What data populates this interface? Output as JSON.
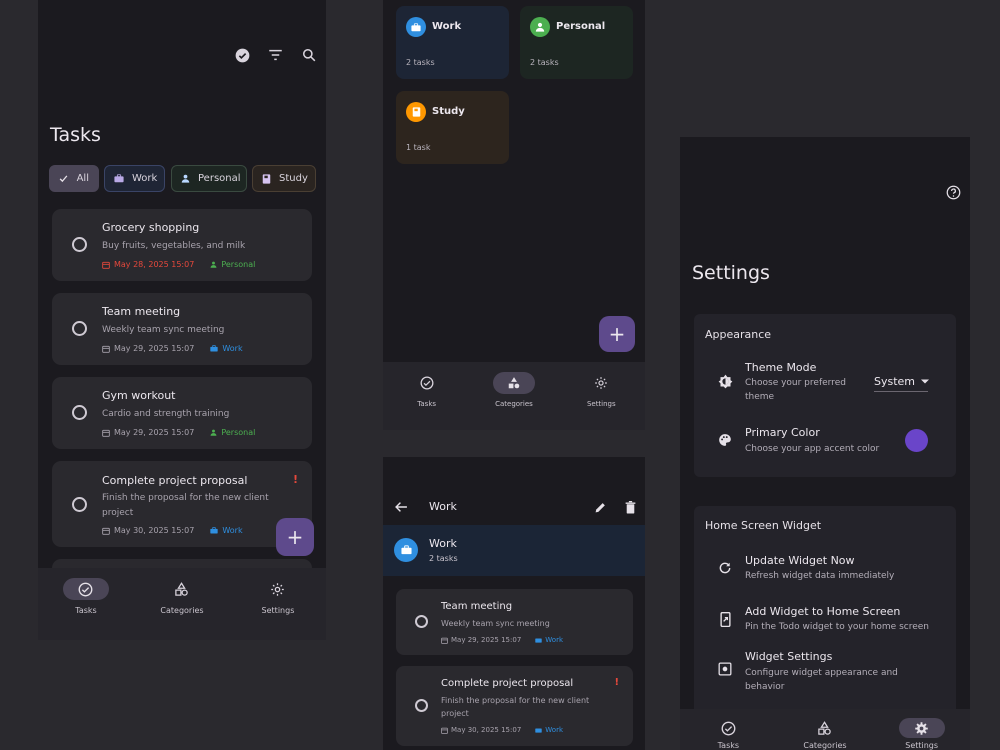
{
  "colors": {
    "accent": "#5e4a8c",
    "work": "#2f8fe0",
    "personal": "#4caf50",
    "study": "#ff9800",
    "danger": "#e5483c"
  },
  "tasks_screen": {
    "title": "Tasks",
    "filters": [
      {
        "label": "All",
        "icon": "check-icon"
      },
      {
        "label": "Work",
        "icon": "briefcase-icon"
      },
      {
        "label": "Personal",
        "icon": "person-icon"
      },
      {
        "label": "Study",
        "icon": "book-icon"
      }
    ],
    "tasks": [
      {
        "title": "Grocery shopping",
        "desc": "Buy fruits, vegetables, and milk",
        "date": "May 28, 2025 15:07",
        "category": "Personal",
        "overdue": true
      },
      {
        "title": "Team meeting",
        "desc": "Weekly team sync meeting",
        "date": "May 29, 2025 15:07",
        "category": "Work"
      },
      {
        "title": "Gym workout",
        "desc": "Cardio and strength training",
        "date": "May 29, 2025 15:07",
        "category": "Personal"
      },
      {
        "title": "Complete project proposal",
        "desc": "Finish the proposal for the new client project",
        "date": "May 30, 2025 15:07",
        "category": "Work",
        "priority": "!"
      }
    ],
    "fab": "+"
  },
  "nav": {
    "tasks": "Tasks",
    "categories": "Categories",
    "settings": "Settings"
  },
  "categories_screen": {
    "cards": [
      {
        "name": "Work",
        "count": "2 tasks"
      },
      {
        "name": "Personal",
        "count": "2 tasks"
      },
      {
        "name": "Study",
        "count": "1 task"
      }
    ],
    "fab": "+"
  },
  "category_detail": {
    "title": "Work",
    "header_name": "Work",
    "header_count": "2 tasks",
    "tasks": [
      {
        "title": "Team meeting",
        "desc": "Weekly team sync meeting",
        "date": "May 29, 2025 15:07",
        "category": "Work"
      },
      {
        "title": "Complete project proposal",
        "desc": "Finish the proposal for the new client project",
        "date": "May 30, 2025 15:07",
        "category": "Work",
        "priority": "!"
      }
    ]
  },
  "settings_screen": {
    "title": "Settings",
    "appearance": {
      "title": "Appearance",
      "theme_mode": {
        "title": "Theme Mode",
        "subtitle": "Choose your preferred theme",
        "value": "System"
      },
      "primary_color": {
        "title": "Primary Color",
        "subtitle": "Choose your app accent color",
        "swatch": "#6a45c9"
      }
    },
    "widget": {
      "title": "Home Screen Widget",
      "update": {
        "title": "Update Widget Now",
        "subtitle": "Refresh widget data immediately"
      },
      "add": {
        "title": "Add Widget to Home Screen",
        "subtitle": "Pin the Todo widget to your home screen"
      },
      "settings": {
        "title": "Widget Settings",
        "subtitle": "Configure widget appearance and behavior"
      }
    }
  }
}
